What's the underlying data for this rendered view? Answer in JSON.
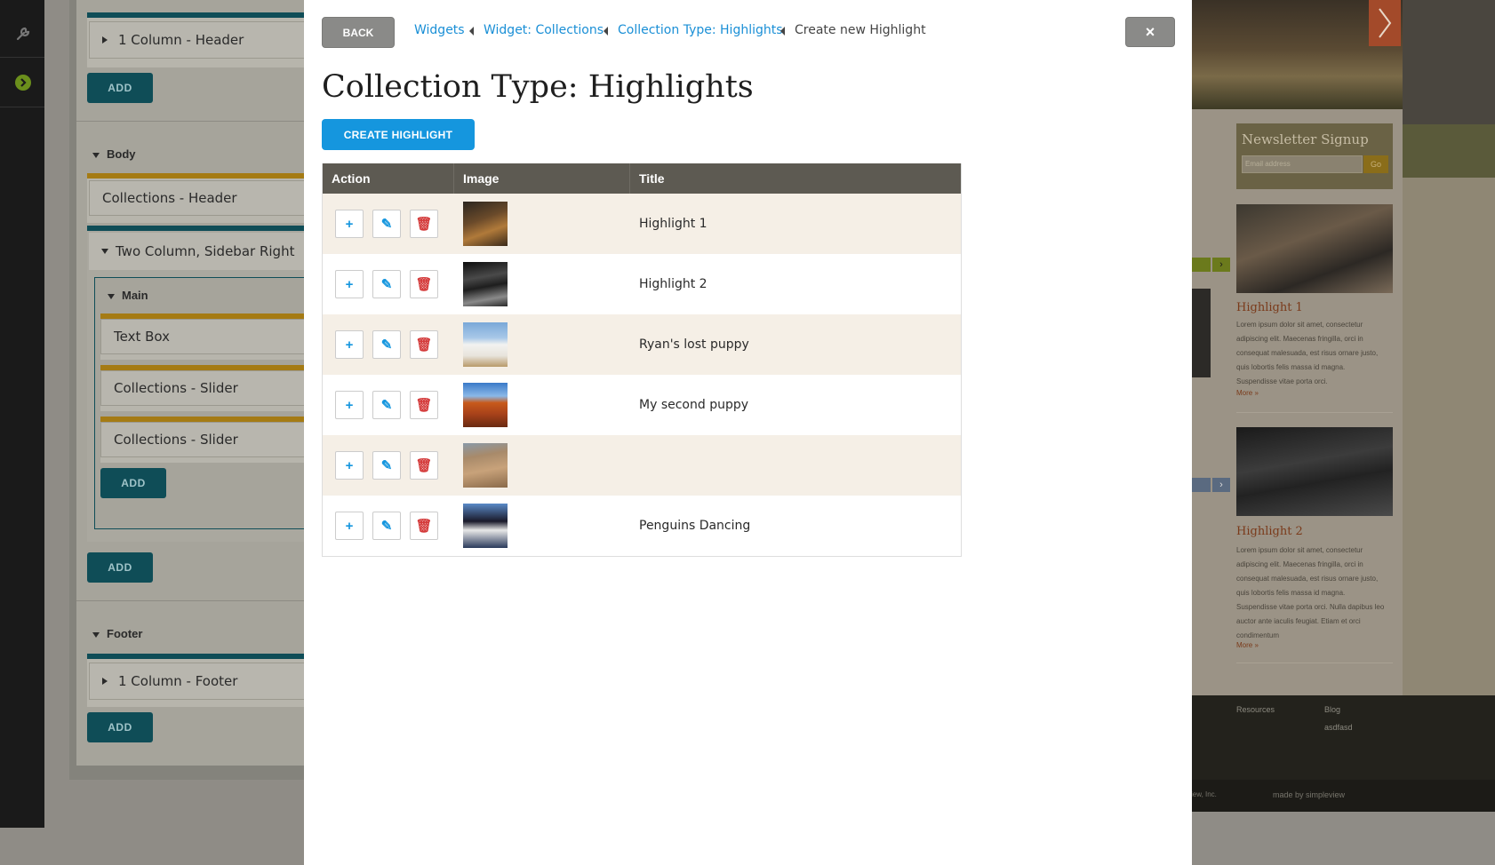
{
  "builder": {
    "header_block": "1 Column - Header",
    "add_label": "ADD",
    "body_section": "Body",
    "collections_header": "Collections - Header",
    "two_col_block": "Two Column, Sidebar Right",
    "main_section": "Main",
    "text_box": "Text Box",
    "slider_1": "Collections - Slider",
    "slider_2": "Collections - Slider",
    "footer_section": "Footer",
    "footer_block": "1 Column - Footer"
  },
  "modal": {
    "back_label": "BACK",
    "close_label": "×",
    "breadcrumbs": [
      "Widgets",
      "Widget: Collections",
      "Collection Type: Highlights",
      "Create new Highlight"
    ],
    "title": "Collection Type: Highlights",
    "create_label": "CREATE HIGHLIGHT",
    "table": {
      "headers": [
        "Action",
        "Image",
        "Title"
      ],
      "rows": [
        {
          "title": "Highlight 1",
          "image": "wine-shop"
        },
        {
          "title": "Highlight 2",
          "image": "restaurant-interior"
        },
        {
          "title": "Ryan's lost puppy",
          "image": "white-mission"
        },
        {
          "title": "My second puppy",
          "image": "red-rock"
        },
        {
          "title": "",
          "image": "desert-cyclist"
        },
        {
          "title": "Penguins Dancing",
          "image": "penguins"
        }
      ]
    }
  },
  "preview": {
    "newsletter_title": "Newsletter Signup",
    "email_placeholder": "Email address",
    "go_label": "Go",
    "highlight1_title": "Highlight 1",
    "highlight1_text": "Lorem ipsum dolor sit amet, consectetur adipiscing elit. Maecenas fringilla, orci in consequat malesuada, est risus ornare justo, quis lobortis felis massa id magna. Suspendisse vitae porta orci.",
    "highlight2_title": "Highlight 2",
    "highlight2_text": "Lorem ipsum dolor sit amet, consectetur adipiscing elit. Maecenas fringilla, orci in consequat malesuada, est risus ornare justo, quis lobortis felis massa id magna. Suspendisse vitae porta orci. Nulla dapibus leo auctor ante iaculis feugiat. Etiam et orci condimentum",
    "more_label": "More »",
    "footer_col1": "Resources",
    "footer_col2": "Blog",
    "footer_col2_item": "asdfasd",
    "made_by": "made by simpleview",
    "copyright_frag": "iew, Inc."
  }
}
